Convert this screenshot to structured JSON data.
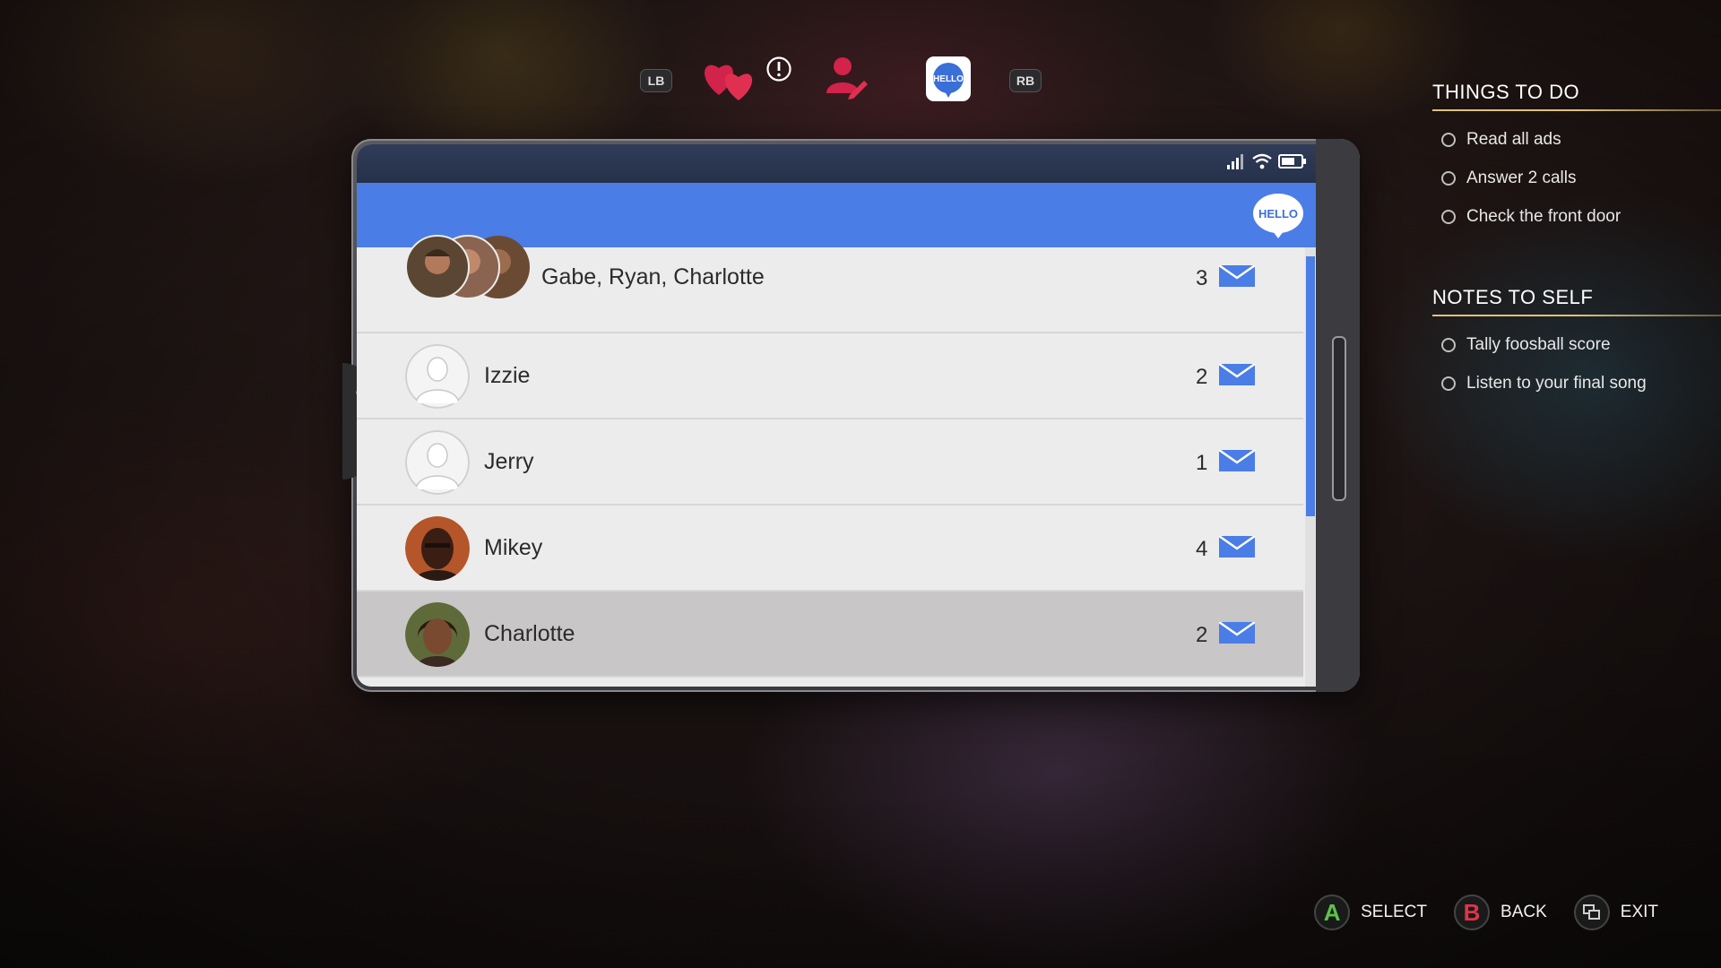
{
  "tabbar": {
    "left_bumper": "LB",
    "right_bumper": "RB",
    "tabs": [
      {
        "icon": "hearts-icon"
      },
      {
        "icon": "alert-icon"
      },
      {
        "icon": "contact-edit-icon"
      },
      {
        "icon": "hello-app-icon",
        "label": "HELLO",
        "active": true
      }
    ]
  },
  "phone": {
    "app_logo_text": "HELLO",
    "status_icons": [
      "signal-icon",
      "wifi-icon",
      "battery-icon"
    ],
    "conversations": [
      {
        "name": "Gabe, Ryan, Charlotte",
        "count": "3",
        "avatar": "group-photo"
      },
      {
        "name": "Izzie",
        "count": "2",
        "avatar": "placeholder"
      },
      {
        "name": "Jerry",
        "count": "1",
        "avatar": "placeholder"
      },
      {
        "name": "Mikey",
        "count": "4",
        "avatar": "photo"
      },
      {
        "name": "Charlotte",
        "count": "2",
        "avatar": "photo",
        "selected": true
      }
    ],
    "accent_color": "#4a7de6"
  },
  "things_to_do": {
    "title": "THINGS TO DO",
    "items": [
      "Read all ads",
      "Answer 2 calls",
      "Check the front door"
    ]
  },
  "notes_to_self": {
    "title": "NOTES TO SELF",
    "items": [
      "Tally foosball score",
      "Listen to your final song"
    ]
  },
  "controls": {
    "select_button": "A",
    "select_label": "SELECT",
    "back_button": "B",
    "back_label": "BACK",
    "exit_label": "EXIT"
  }
}
